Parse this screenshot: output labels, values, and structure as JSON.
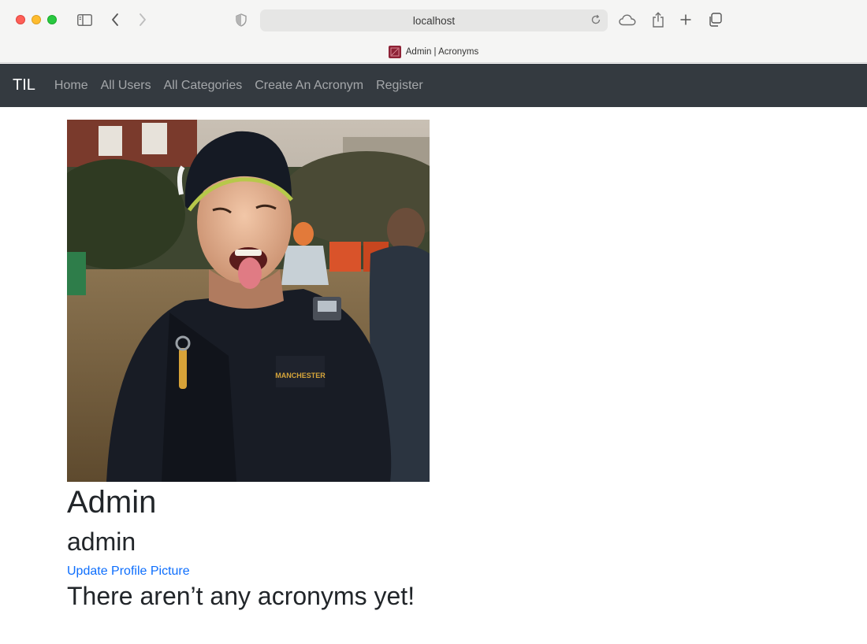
{
  "browser": {
    "url": "localhost",
    "tab_title": "Admin | Acronyms",
    "icons": [
      "sidebar-icon",
      "back-icon",
      "forward-icon",
      "shield-icon",
      "reload-icon",
      "cloud-icon",
      "share-icon",
      "new-tab-icon",
      "tabs-overview-icon"
    ]
  },
  "navbar": {
    "brand": "TIL",
    "links": [
      {
        "label": "Home"
      },
      {
        "label": "All Users"
      },
      {
        "label": "All Categories"
      },
      {
        "label": "Create An Acronym"
      },
      {
        "label": "Register"
      }
    ]
  },
  "profile": {
    "name": "Admin",
    "username": "admin",
    "update_picture_label": "Update Profile Picture",
    "empty_message": "There aren’t any acronyms yet!"
  },
  "colors": {
    "navbar_bg": "#343a40",
    "link_blue": "#0d6efd"
  }
}
